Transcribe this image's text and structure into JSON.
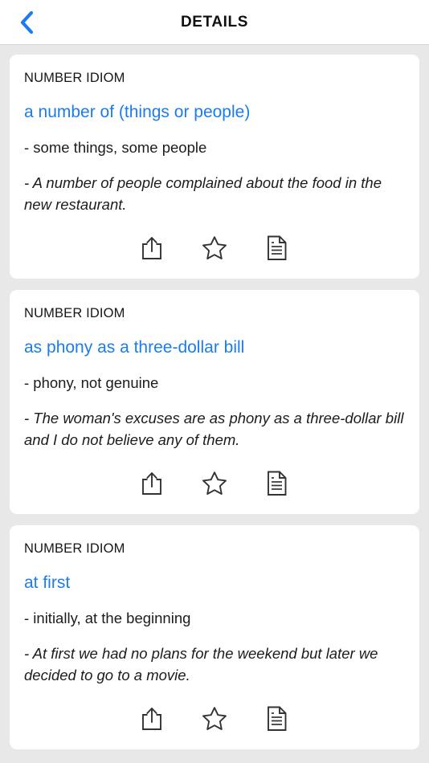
{
  "header": {
    "title": "DETAILS",
    "back_icon": "chevron-left-icon",
    "accent_color": "#1c7ced"
  },
  "theme": {
    "background": "#e8e8e8",
    "card_background": "#ffffff",
    "link_color": "#1c7ced",
    "text_color": "#1c1c1c",
    "icon_color": "#333333"
  },
  "actions": {
    "share_label": "share-icon",
    "favorite_label": "star-icon",
    "note_label": "document-icon"
  },
  "cards": [
    {
      "category": "NUMBER IDIOM",
      "idiom": "a number of (things or people)",
      "definition": "- some things, some people",
      "example": "- A number of people complained about the food in the new restaurant."
    },
    {
      "category": "NUMBER IDIOM",
      "idiom": "as phony as a three-dollar bill",
      "definition": "- phony, not genuine",
      "example": "- The woman's excuses are as phony as a three-dollar bill and I do not believe any of them."
    },
    {
      "category": "NUMBER IDIOM",
      "idiom": "at first",
      "definition": "- initially, at the beginning",
      "example": "- At first we had no plans for the weekend but later we decided to go to a movie."
    }
  ]
}
